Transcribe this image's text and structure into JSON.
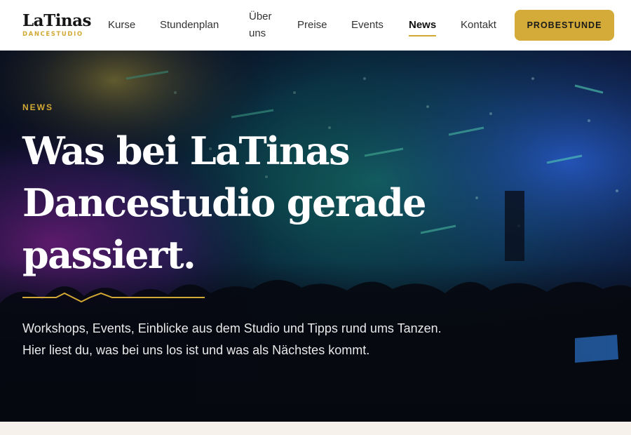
{
  "brand": {
    "name": "LaTinas",
    "subtitle": "DANCESTUDIO",
    "accent_color": "#d2a935"
  },
  "nav": {
    "items": [
      {
        "label": "Kurse"
      },
      {
        "label": "Stundenplan"
      },
      {
        "label": "Über uns"
      },
      {
        "label": "Preise"
      },
      {
        "label": "Events"
      },
      {
        "label": "News",
        "active": true
      },
      {
        "label": "Kontakt"
      }
    ],
    "cta_label": "PROBESTUNDE"
  },
  "hero": {
    "eyebrow": "NEWS",
    "title": "Was bei LaTinas Dancestudio gerade passiert.",
    "text": "Workshops, Events, Einblicke aus dem Studio und Tipps rund ums Tanzen. Hier liest du, was bei uns los ist und was als Nächstes kommt.",
    "background": "concert-crowd-image"
  }
}
